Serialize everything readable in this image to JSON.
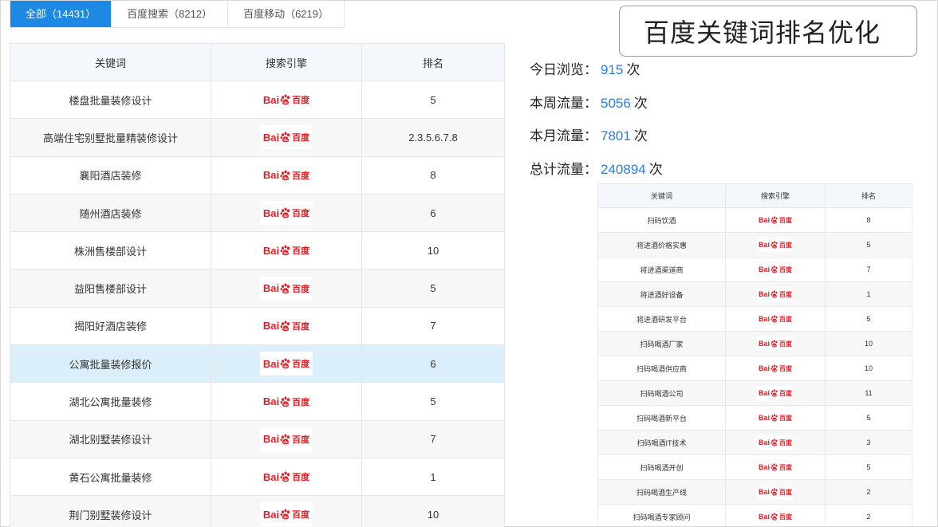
{
  "tabs": [
    {
      "label": "全部（14431）",
      "active": true
    },
    {
      "label": "百度搜索（8212）",
      "active": false
    },
    {
      "label": "百度移动（6219）",
      "active": false
    }
  ],
  "title": "百度关键词排名优化",
  "table_headers": {
    "keyword": "关键词",
    "engine": "搜索引擎",
    "rank": "排名"
  },
  "engine_logo": {
    "text_left": "Bai",
    "text_right": "百度",
    "icon": "baidu-paw-icon",
    "color": "#de1f26"
  },
  "main_rows": [
    {
      "keyword": "楼盘批量装修设计",
      "rank": "5"
    },
    {
      "keyword": "高端住宅别墅批量精装修设计",
      "rank": "2.3.5.6.7.8"
    },
    {
      "keyword": "襄阳酒店装修",
      "rank": "8"
    },
    {
      "keyword": "随州酒店装修",
      "rank": "6"
    },
    {
      "keyword": "株洲售楼部设计",
      "rank": "10"
    },
    {
      "keyword": "益阳售楼部设计",
      "rank": "5"
    },
    {
      "keyword": "揭阳好酒店装修",
      "rank": "7"
    },
    {
      "keyword": "公寓批量装修报价",
      "rank": "6"
    },
    {
      "keyword": "湖北公寓批量装修",
      "rank": "5"
    },
    {
      "keyword": "湖北别墅装修设计",
      "rank": "7"
    },
    {
      "keyword": "黄石公寓批量装修",
      "rank": "1"
    },
    {
      "keyword": "荆门别墅装修设计",
      "rank": "10"
    }
  ],
  "stats": [
    {
      "label": "今日浏览：",
      "value": "915",
      "unit": "次"
    },
    {
      "label": "本周流量：",
      "value": "5056",
      "unit": "次"
    },
    {
      "label": "本月流量：",
      "value": "7801",
      "unit": "次"
    },
    {
      "label": "总计流量：",
      "value": "240894",
      "unit": "次"
    }
  ],
  "small_rows": [
    {
      "keyword": "扫码饮酒",
      "rank": "8"
    },
    {
      "keyword": "将进酒价格实惠",
      "rank": "5"
    },
    {
      "keyword": "将进酒渠道商",
      "rank": "7"
    },
    {
      "keyword": "将进酒好设备",
      "rank": "1"
    },
    {
      "keyword": "将进酒研发平台",
      "rank": "5"
    },
    {
      "keyword": "扫码喝酒厂家",
      "rank": "10"
    },
    {
      "keyword": "扫码喝酒供应商",
      "rank": "10"
    },
    {
      "keyword": "扫码喝酒公司",
      "rank": "11"
    },
    {
      "keyword": "扫码喝酒新平台",
      "rank": "5"
    },
    {
      "keyword": "扫码喝酒IT技术",
      "rank": "3"
    },
    {
      "keyword": "扫码喝酒开创",
      "rank": "5"
    },
    {
      "keyword": "扫码喝酒生产线",
      "rank": "2"
    },
    {
      "keyword": "扫码喝酒专家顾问",
      "rank": "2"
    }
  ]
}
